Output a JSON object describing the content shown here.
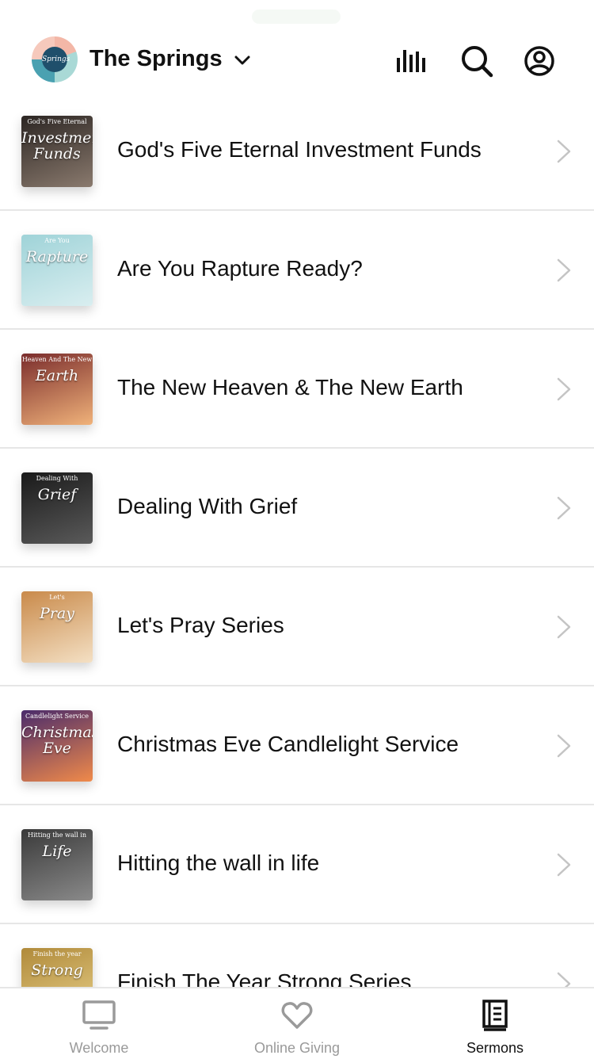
{
  "header": {
    "church_name": "The Springs",
    "logo_text": "Springs"
  },
  "sermons": [
    {
      "title": "God's Five Eternal Investment Funds",
      "thumb_text": "Investment Funds",
      "thumb_sub": "God's Five Eternal",
      "thumb_colors": [
        "#2b2522",
        "#8a7a6e"
      ]
    },
    {
      "title": "Are You Rapture Ready?",
      "thumb_text": "Rapture",
      "thumb_sub": "Are You",
      "thumb_colors": [
        "#9fd3d8",
        "#d9eef0"
      ]
    },
    {
      "title": "The New Heaven & The New Earth",
      "thumb_text": "Earth",
      "thumb_sub": "Heaven And The New",
      "thumb_colors": [
        "#7a2c2c",
        "#f0b27a"
      ]
    },
    {
      "title": "Dealing With Grief",
      "thumb_text": "Grief",
      "thumb_sub": "Dealing With",
      "thumb_colors": [
        "#1a1a1a",
        "#5a5a5a"
      ]
    },
    {
      "title": "Let's Pray Series",
      "thumb_text": "Pray",
      "thumb_sub": "Let's",
      "thumb_colors": [
        "#c98a4a",
        "#f4e0c4"
      ]
    },
    {
      "title": "Christmas Eve Candlelight Service",
      "thumb_text": "Christmas Eve",
      "thumb_sub": "Candlelight Service",
      "thumb_colors": [
        "#4a2b6b",
        "#f08a4a"
      ]
    },
    {
      "title": "Hitting the wall in life",
      "thumb_text": "Life",
      "thumb_sub": "Hitting the wall in",
      "thumb_colors": [
        "#3a3a3a",
        "#8a8a8a"
      ]
    },
    {
      "title": "Finish The Year Strong Series",
      "thumb_text": "Strong",
      "thumb_sub": "Finish the year",
      "thumb_colors": [
        "#b08a3a",
        "#e8d08a"
      ]
    }
  ],
  "tabs": [
    {
      "label": "Welcome",
      "icon": "tv-icon",
      "active": false
    },
    {
      "label": "Online Giving",
      "icon": "heart-icon",
      "active": false
    },
    {
      "label": "Sermons",
      "icon": "book-icon",
      "active": true
    }
  ],
  "colors": {
    "text": "#111111",
    "inactive_tab": "#9a9a9a",
    "divider": "#e6e6e6",
    "chevron": "#c4c4c4"
  }
}
